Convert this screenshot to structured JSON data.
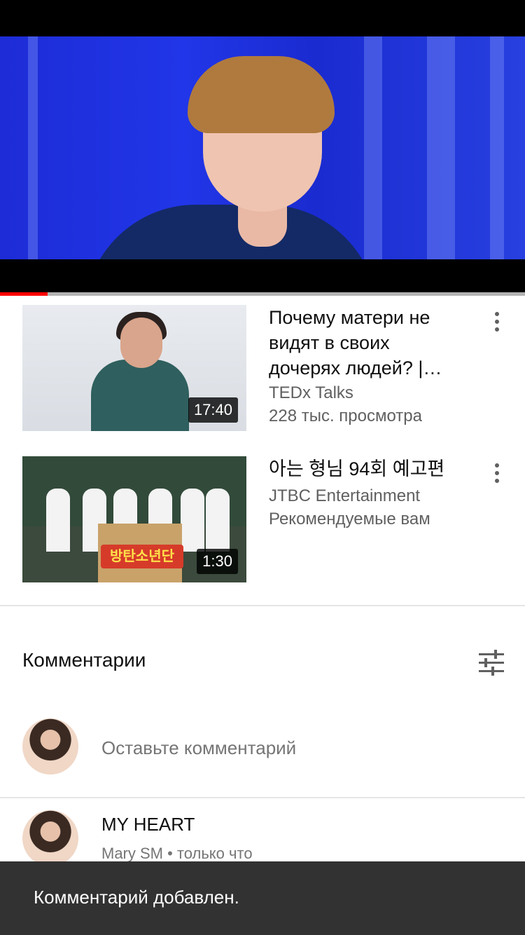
{
  "player": {
    "progress_percent": 9,
    "accent_color": "#ff0000"
  },
  "videos": [
    {
      "title": "Почему матери не видят в своих дочерях людей? |…",
      "channel": "TEDx Talks",
      "info": "228 тыс. просмотра",
      "duration": "17:40"
    },
    {
      "title": "아는 형님 94회 예고편",
      "channel": "JTBC Entertainment",
      "info": "Рекомендуемые вам",
      "duration": "1:30",
      "thumb_banner": "방탄소년단"
    }
  ],
  "comments": {
    "header": "Комментарии",
    "placeholder": "Оставьте комментарий",
    "items": [
      {
        "text": "MY HEART",
        "author": "Mary SM",
        "time": " • только что"
      }
    ]
  },
  "snackbar": {
    "text": "Комментарий добавлен."
  },
  "icons": {
    "more": "more-vert-icon",
    "sort": "sort-filter-icon"
  }
}
